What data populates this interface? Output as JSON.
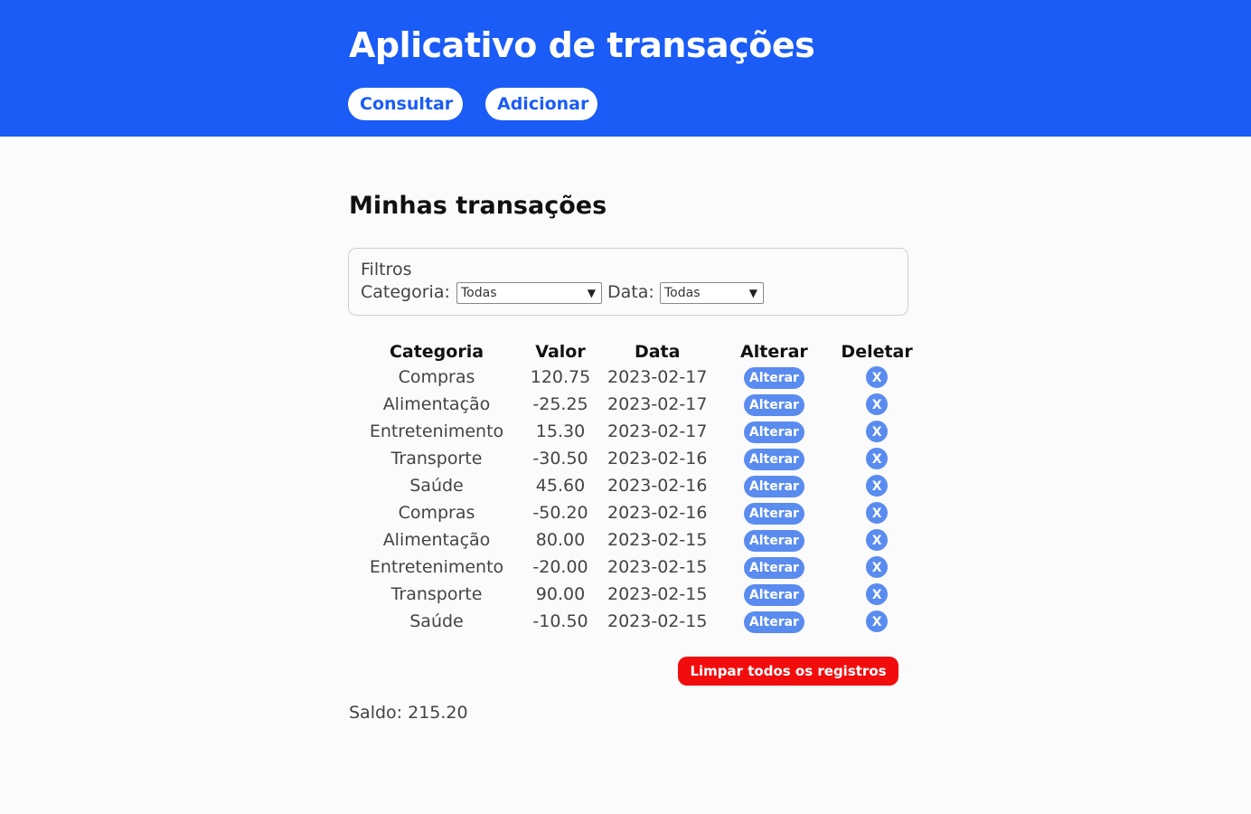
{
  "header": {
    "title": "Aplicativo de transações",
    "nav": {
      "consultar": "Consultar",
      "adicionar": "Adicionar"
    }
  },
  "main": {
    "title": "Minhas transações",
    "filters": {
      "legend": "Filtros",
      "categoria_label": "Categoria:",
      "categoria_value": "Todas",
      "data_label": "Data:",
      "data_value": "Todas"
    },
    "table": {
      "headers": [
        "Categoria",
        "Valor",
        "Data",
        "Alterar",
        "Deletar"
      ],
      "alterar_label": "Alterar",
      "deletar_label": "X",
      "rows": [
        {
          "categoria": "Compras",
          "valor": "120.75",
          "data": "2023-02-17"
        },
        {
          "categoria": "Alimentação",
          "valor": "-25.25",
          "data": "2023-02-17"
        },
        {
          "categoria": "Entretenimento",
          "valor": "15.30",
          "data": "2023-02-17"
        },
        {
          "categoria": "Transporte",
          "valor": "-30.50",
          "data": "2023-02-16"
        },
        {
          "categoria": "Saúde",
          "valor": "45.60",
          "data": "2023-02-16"
        },
        {
          "categoria": "Compras",
          "valor": "-50.20",
          "data": "2023-02-16"
        },
        {
          "categoria": "Alimentação",
          "valor": "80.00",
          "data": "2023-02-15"
        },
        {
          "categoria": "Entretenimento",
          "valor": "-20.00",
          "data": "2023-02-15"
        },
        {
          "categoria": "Transporte",
          "valor": "90.00",
          "data": "2023-02-15"
        },
        {
          "categoria": "Saúde",
          "valor": "-10.50",
          "data": "2023-02-15"
        }
      ]
    },
    "clear_button": "Limpar todos os registros",
    "saldo": "Saldo: 215.20"
  },
  "colors": {
    "header_bg": "#1a5cf5",
    "button_blue": "#5a8cf0",
    "danger": "#f20d0d"
  }
}
